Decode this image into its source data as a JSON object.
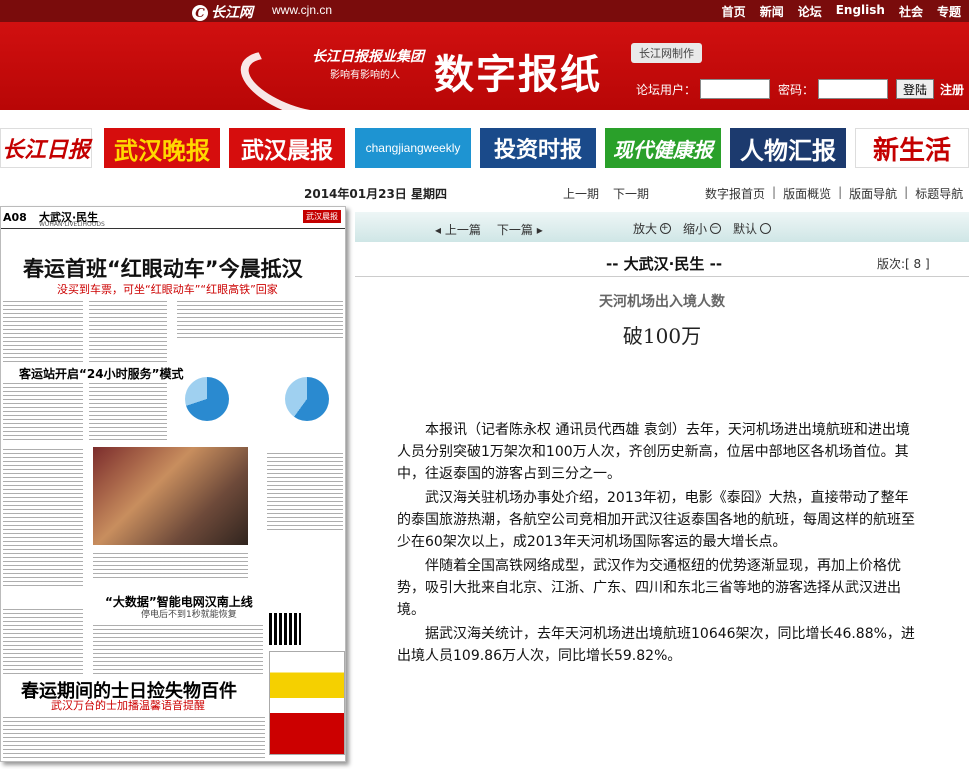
{
  "site": {
    "logo_text": "长江网",
    "url": "www.cjn.cn",
    "nav": [
      "首页",
      "新闻",
      "论坛",
      "English",
      "社会",
      "专题"
    ]
  },
  "banner": {
    "group_name": "长江日报报业集团",
    "slogan": "影响有影响的人",
    "title": "数字报纸",
    "made_by": "长江网制作",
    "login": {
      "user_label": "论坛用户：",
      "password_label": "密码：",
      "user_value": "",
      "password_value": "",
      "login_button": "登陆",
      "register": "注册"
    }
  },
  "papers": [
    "长江日报",
    "武汉晚报",
    "武汉晨报",
    "changjiangweekly",
    "投资时报",
    "现代健康报",
    "人物汇报",
    "新生活"
  ],
  "date_bar": {
    "date": "2014年01月23日 星期四",
    "prev_issue": "上一期",
    "next_issue": "下一期",
    "links": [
      "数字报首页",
      "版面概览",
      "版面导航",
      "标题导航"
    ]
  },
  "page_image": {
    "page_num": "A08",
    "section": "大武汉·民生",
    "section_en": "WUHAN·LIVELIHOODS",
    "brand": "武汉晨报",
    "headline": "春运首班“红眼动车”今晨抵汉",
    "headline_sub": "没买到车票，可坐“红眼动车”“红眼高铁”回家",
    "h2": "客运站开启“24小时服务”模式",
    "mid_headline": "“大数据”智能电网汉南上线",
    "mid_sub": "停电后不到1秒就能恢复",
    "big_headline": "春运期间的士日捡失物百件",
    "big_sub": "武汉万台的士加播温馨语音提醒"
  },
  "toolbar": {
    "prev_article": "上一篇",
    "next_article": "下一篇",
    "zoom_in": "放大",
    "zoom_out": "缩小",
    "default": "默认"
  },
  "article": {
    "section_title": "-- 大武汉·民生 --",
    "page_no": "版次:[ 8 ]",
    "subtitle": "天河机场出入境人数",
    "title": "破100万",
    "paragraphs": [
      "本报讯（记者陈永权 通讯员代西雄 袁剑）去年，天河机场进出境航班和进出境人员分别突破1万架次和100万人次，齐创历史新高，位居中部地区各机场首位。其中，往返泰国的游客占到三分之一。",
      "武汉海关驻机场办事处介绍，2013年初，电影《泰囧》大热，直接带动了整年的泰国旅游热潮，各航空公司竞相加开武汉往返泰国各地的航班，每周这样的航班至少在60架次以上，成2013年天河机场国际客运的最大增长点。",
      "伴随着全国高铁网络成型，武汉作为交通枢纽的优势逐渐显现，再加上价格优势，吸引大批来自北京、江浙、广东、四川和东北三省等地的游客选择从武汉进出境。",
      "据武汉海关统计，去年天河机场进出境航班10646架次，同比增长46.88%，进出境人员109.86万人次，同比增长59.82%。"
    ]
  },
  "colors": {
    "banner_red": "#c40a0a",
    "toolbar_teal": "#d8ecec"
  }
}
